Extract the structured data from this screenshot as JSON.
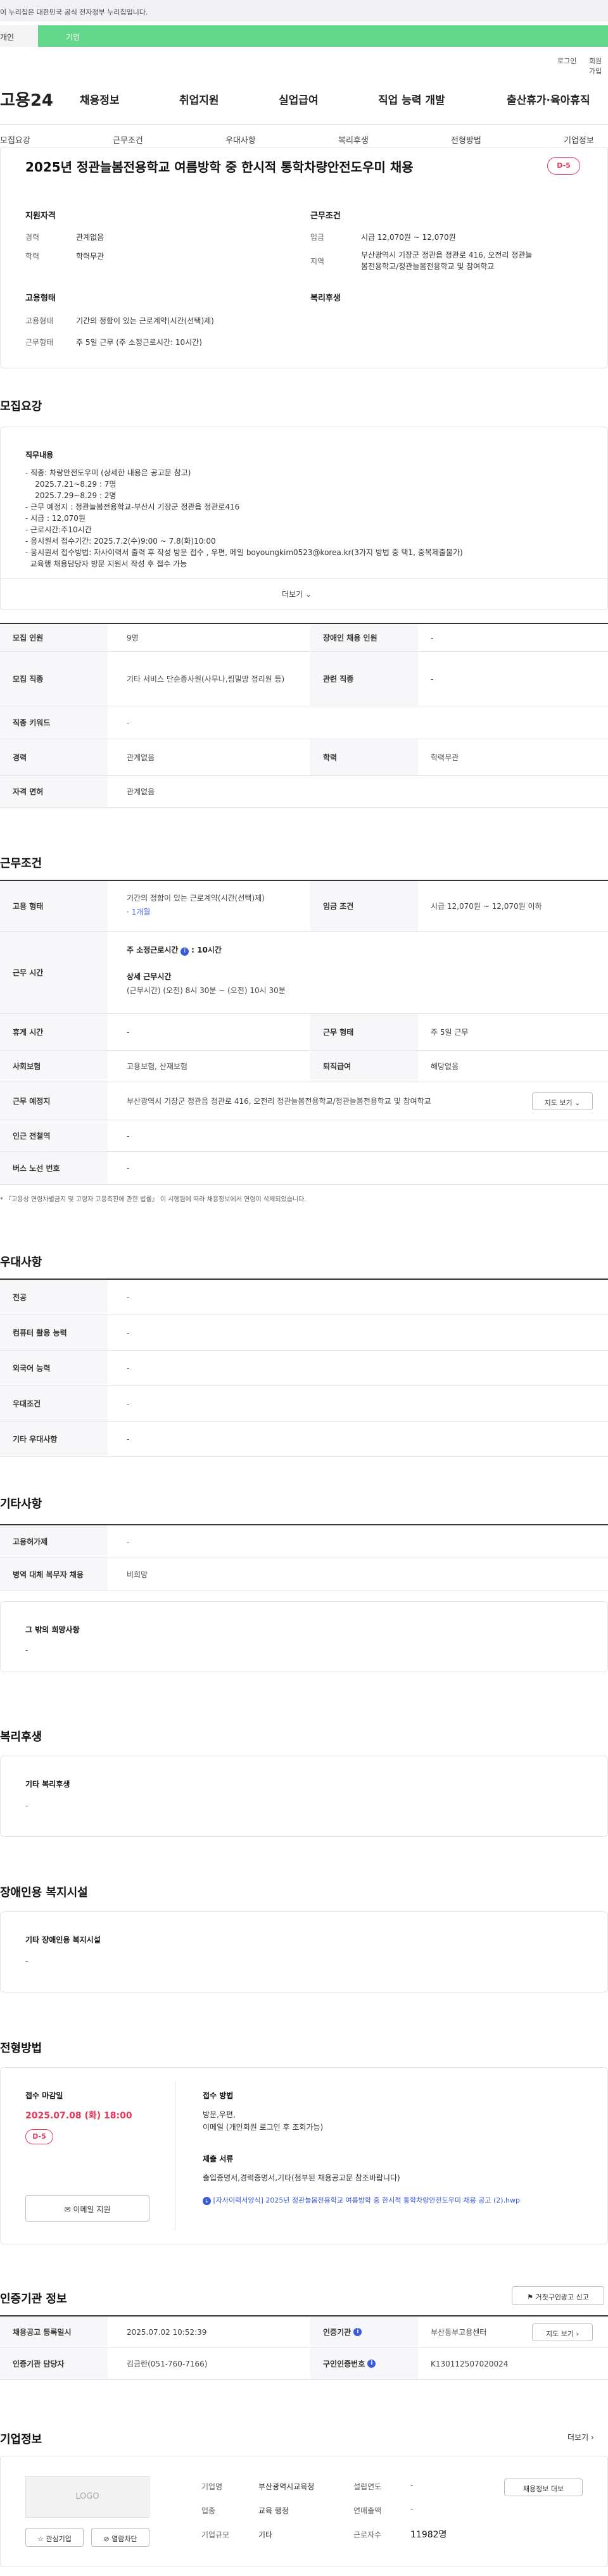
{
  "gov_banner": "이 누리집은 대한민국 공식 전자정부 누리집입니다.",
  "tabs": {
    "person": "개인",
    "company": "기업"
  },
  "util": {
    "login": "로그인",
    "join": "회원가입"
  },
  "logo": "고용24",
  "gnb": [
    "채용정보",
    "취업지원",
    "실업급여",
    "직업 능력 개발",
    "출산휴가·육아휴직"
  ],
  "subnav": [
    "모집요강",
    "근무조건",
    "우대사항",
    "복리후생",
    "전형방법",
    "기업정보"
  ],
  "job": {
    "title": "2025년 정관늘봄전용학교 여름방학 중 한시적 통학차량안전도우미 채용",
    "dday": "D-5",
    "qual_title": "지원자격",
    "career_label": "경력",
    "career_value": "관계없음",
    "edu_label": "학력",
    "edu_value": "학력무관",
    "cond_title": "근무조건",
    "wage_label": "임금",
    "wage_value": "시급 12,070원 ~ 12,070원",
    "region_label": "지역",
    "region_value_1": "부산광역시 기장군 정관읍 정관로 416, 오전리 정관늘",
    "region_value_2": "봄전용학교/정관늘봄전용학교 및 참여학교",
    "form_title": "고용형태",
    "type_label": "고용형태",
    "type_value": "기간의 정함이 있는 근로계약(시간(선택)제)",
    "shape_label": "근무형태",
    "shape_value": "주 5일 근무 (주 소정근로시간: 10시간)",
    "benefit_title": "복리후생"
  },
  "recruit": {
    "section_title": "모집요강",
    "duty_title": "직무내용",
    "duty_lines": [
      "- 직종: 차량안전도우미 (상세한 내용은 공고문 참고)",
      "    2025.7.21~8.29 : 7명",
      "    2025.7.29~8.29 : 2명",
      "- 근무 예정지 : 정관늘봄전용학교-부산시 기장군 정관읍 정관로416",
      "- 시급 : 12,070원",
      "- 근로시간:주10시간",
      "- 응시원서 접수기간: 2025.7.2(수)9:00 ~ 7.8(화)10:00",
      "- 응시원서 접수방법: 자사이력서 출력 후 작성 방문 접수 , 우편, 메일 boyoungkim0523@korea.kr(3가지 방법 중 택1, 중복제출불가)",
      "  교육행 채용담당자 방문 지원서 작성 후 접수 가능"
    ],
    "more": "더보기",
    "rows": [
      {
        "k1": "모집 인원",
        "v1": "9명",
        "k2": "장애인 채용 인원",
        "v2": "-"
      },
      {
        "k1": "모집 직종",
        "v1": "기타 서비스 단순종사원(사무나,림밀방 정리원 등)",
        "k2": "관련 직종",
        "v2": "-"
      },
      {
        "k1": "직종 키워드",
        "v1": "-"
      },
      {
        "k1": "경력",
        "v1": "관계없음",
        "k2": "학력",
        "v2": "학력무관"
      },
      {
        "k1": "자격 면허",
        "v1": "관계없음"
      }
    ]
  },
  "work": {
    "section_title": "근무조건",
    "type_label": "고용 형태",
    "type_value_1": "기간의 정함이 있는 근로계약(시간(선택)제)",
    "type_value_2": "· 1개월",
    "wage_label": "임금 조건",
    "wage_value": "시급 12,070원 ~ 12,070원 이하",
    "time_label": "근무 시간",
    "time_a": "주 소정근로시간",
    "time_a_val": ": 10시간",
    "time_b": "상세 근무시간",
    "time_b_val": "(근무시간) (오전) 8시 30분 ~ (오전) 10시 30분",
    "rest_label": "휴게 시간",
    "rest_value": "-",
    "shape_label": "근무 형태",
    "shape_value": "주 5일 근무",
    "ins_label": "사회보험",
    "ins_value": "고용보험, 산재보험",
    "retire_label": "퇴직급여",
    "retire_value": "해당없음",
    "place_label": "근무 예정지",
    "place_value": "부산광역시 기장군 정관읍 정관로 416, 오전리 정관늘봄전용학교/정관늘봄전용학교 및 참여학교",
    "map": "지도 보기",
    "subway_label": "인근 전철역",
    "subway_value": "-",
    "bus_label": "버스 노선 번호",
    "bus_value": "-",
    "note": "* 『고용상 연령차별금지 및 고령자 고용촉진에 관한 법률』 이 시행됨에 따라 채용정보에서 연령이 삭제되었습니다."
  },
  "pref": {
    "section_title": "우대사항",
    "rows": [
      {
        "k": "전공",
        "v": "-"
      },
      {
        "k": "컴퓨터 활용 능력",
        "v": "-"
      },
      {
        "k": "외국어 능력",
        "v": "-"
      },
      {
        "k": "우대조건",
        "v": "-"
      },
      {
        "k": "기타 우대사항",
        "v": "-"
      }
    ]
  },
  "etc": {
    "section_title": "기타사항",
    "rows": [
      {
        "k": "고용허가제",
        "v": "-"
      },
      {
        "k": "병역 대체 복무자 채용",
        "v": "비희망"
      }
    ],
    "other_title": "그 밖의 희망사항",
    "other_value": "-"
  },
  "welfare": {
    "section_title": "복리후생",
    "sub": "기타 복리후생",
    "value": "-"
  },
  "disab": {
    "section_title": "장애인용 복지시설",
    "sub": "기타 장애인용 복지시설",
    "value": "-"
  },
  "process": {
    "section_title": "전형방법",
    "deadline_label": "접수 마감일",
    "deadline": "2025.07.08 (화) 18:00",
    "dday": "D-5",
    "email_btn": "이메일 지원",
    "method_label": "접수 방법",
    "method_1": "방문,우편,",
    "method_2": "이메일 (개인회원 로그인 후 조회가능)",
    "docs_label": "제출 서류",
    "docs_value": "출입증명서,경력증명서,기타(첨부된 채용공고문 참조바랍니다)",
    "attach": "[자사이력서양식] 2025년 정관늘봄전용학교 여름방학 중 한시적 통학차량안전도우미 채용 공고 (2).hwp"
  },
  "agency": {
    "section_title": "인증기관 정보",
    "report_btn": "거짓구인광고 신고",
    "r1_k1": "채용공고 등록일시",
    "r1_v1": "2025.07.02 10:52:39",
    "r1_k2": "인증기관",
    "r1_v2": "부산동부고용센터",
    "map": "지도 보기",
    "r2_k1": "인증기관 담당자",
    "r2_v1": "김금란(051-760-7166)",
    "r2_k2": "구인인증번호",
    "r2_v2": "K130112507020024"
  },
  "company": {
    "section_title": "기업정보",
    "more": "더보기",
    "logo": "LOGO",
    "fav": "관심기업",
    "block": "열람차단",
    "name_k": "기업명",
    "name_v": "부산광역시교육청",
    "found_k": "설립연도",
    "found_v": "-",
    "ind_k": "업종",
    "ind_v": "교육 행정",
    "sales_k": "연매출액",
    "sales_v": "-",
    "size_k": "기업규모",
    "size_v": "기타",
    "emp_k": "근로자수",
    "emp_v": "11982명",
    "jobs_btn": "채용정보 더보"
  }
}
